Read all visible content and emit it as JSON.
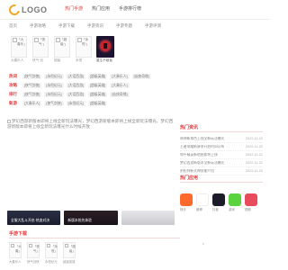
{
  "logo": {
    "text": "LOGO"
  },
  "nav": {
    "items": [
      {
        "label": "热门手游",
        "active": true
      },
      {
        "label": "热门应用",
        "active": false
      },
      {
        "label": "手游排行榜",
        "active": false
      }
    ]
  },
  "sub_nav": {
    "items": [
      "首页",
      "手游攻略",
      "手游下载",
      "手游资讯",
      "手游专题",
      "手游评测"
    ]
  },
  "hot_games": [
    {
      "thumbtext": "「大奏乐」",
      "title": "大奏乐人"
    },
    {
      "thumbtext": "「侠气·」",
      "title": "侠气·剑"
    },
    {
      "thumbtext": "「超级·」",
      "title": "超级"
    },
    {
      "thumbtext": "「永恒·」",
      "title": "永恒"
    }
  ],
  "feature_game": {
    "title": "重生不破者"
  },
  "tags": [
    {
      "label": "热词",
      "items": [
        "[侠气剑侠]",
        "[永恒纪元]",
        "[大话西游]",
        "[超级英雄]",
        "[大奏乐人]",
        "[仙侠奇缘]"
      ]
    },
    {
      "label": "攻略",
      "items": [
        "[侠气剑侠]",
        "[永恒纪元]",
        "[大话西游]",
        "[超级英雄]",
        "[大奏乐人]"
      ]
    },
    {
      "label": "排行",
      "items": [
        "[侠气剑侠]",
        "[永恒纪元]",
        "[大话西游]",
        "[超级英雄]",
        "[仙侠奇缘]"
      ]
    },
    {
      "label": "新游",
      "items": [
        "[大奏乐人]",
        "[侠气剑侠]",
        "[永恒纪元]",
        "[超级英雄]"
      ]
    }
  ],
  "headline": "梦幻西游新版本即将上线全新玩法曝光，梦幻西游新版本即将上线全新玩法曝光，梦幻西游新版本即将上线全新玩法曝光什么时候开放",
  "banners": [
    {
      "caption": "全服大乱斗开启·热血对决",
      "color": "#2b2f44"
    },
    {
      "caption": "新版本抢先体验",
      "color": "#2a1f25"
    },
    {
      "caption": "",
      "color": "#e7e7ea"
    }
  ],
  "news": {
    "title": "热门资讯",
    "items": [
      {
        "text": "原神新角色上线全新玩法曝光",
        "date": "2022-11-22"
      },
      {
        "text": "王者荣耀新赛季开启时间公布",
        "date": "2022-11-22"
      },
      {
        "text": "和平精英新地图即将上线",
        "date": "2022-11-21"
      },
      {
        "text": "梦幻西游新版本全新玩法曝光",
        "date": "2022-11-21"
      },
      {
        "text": "阴阳师新式神技能介绍",
        "date": "2022-11-20"
      },
      {
        "text": "明日方舟新活动奖励一览",
        "date": "2022-11-20"
      },
      {
        "text": "崩坏3新角色上线时间",
        "date": "2022-11-19"
      },
      {
        "text": "第五人格新皮肤曝光",
        "date": "2022-11-19"
      }
    ]
  },
  "apps": {
    "title": "热门应用",
    "items": [
      {
        "name": "快手",
        "color": "#ff5a2c"
      },
      {
        "name": "微博",
        "color": "#ffffff"
      },
      {
        "name": "抖音",
        "color": "#1b1b2a"
      },
      {
        "name": "游戏",
        "color": "#5ad33f"
      },
      {
        "name": "视频",
        "color": "#e84b5c"
      }
    ]
  },
  "bottom": {
    "title": "手游下载",
    "items": [
      {
        "thumbtext": "「大奏」",
        "name": "大奏乐人"
      },
      {
        "thumbtext": "「侠气」",
        "name": "侠气剑侠"
      },
      {
        "thumbtext": "「永恒」",
        "name": "永恒纪元"
      },
      {
        "thumbtext": "「超级」",
        "name": "超级英雄"
      }
    ]
  },
  "watermark": {
    "text": "便民库"
  }
}
